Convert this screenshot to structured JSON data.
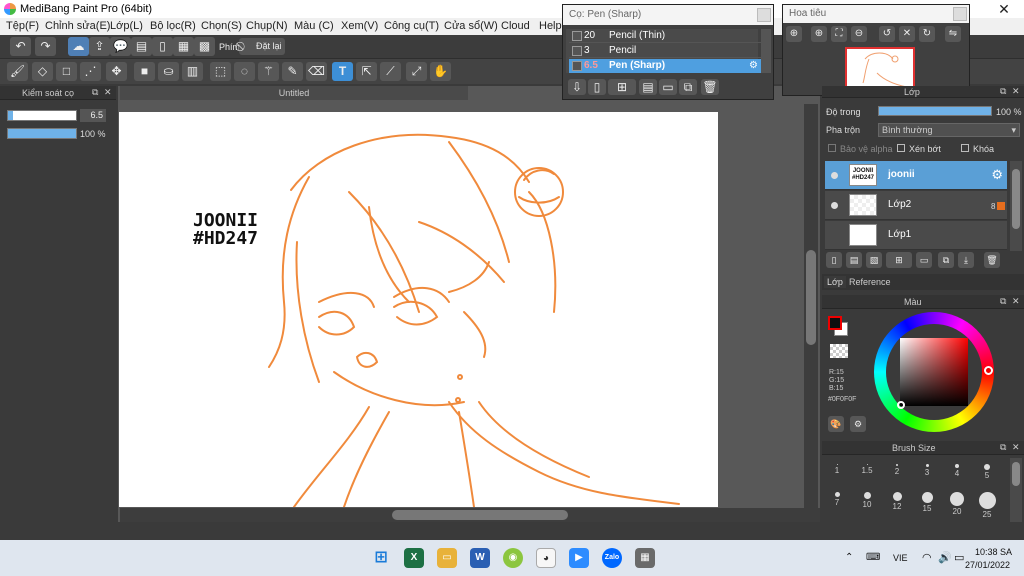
{
  "app": {
    "title": "MediBang Paint Pro (64bit)",
    "close_glyph": "✕"
  },
  "menu": [
    "Tệp(F)",
    "Chỉnh sửa(E)",
    "Lớp(L)",
    "Bộ lọc(R)",
    "Chọn(S)",
    "Chụp(N)",
    "Màu (C)",
    "Xem(V)",
    "Công cụ(T)",
    "Cửa sổ(W)",
    "Cloud",
    "Help"
  ],
  "toolbar": {
    "key_label": "Phím",
    "reset_label": "Đặt lại"
  },
  "brush_control": {
    "title": "Kiểm soát cọ",
    "size_value": "6.5",
    "opacity_value": "100 %",
    "size_fraction": 0.07,
    "opacity_fraction": 1.0
  },
  "canvas": {
    "tab": "Untitled",
    "signature_line1": "JOONII",
    "signature_line2": "#HD247"
  },
  "brush_list": {
    "title": "Cọ: Pen (Sharp)",
    "items": [
      {
        "size": "20",
        "name": "Pencil (Thin)"
      },
      {
        "size": "3",
        "name": "Pencil"
      },
      {
        "size": "6.5",
        "name": "Pen (Sharp)",
        "selected": true
      }
    ]
  },
  "navigator": {
    "title": "Hoa tiêu"
  },
  "layers": {
    "header": "Lớp",
    "opacity_label": "Độ trong",
    "opacity_value": "100 %",
    "opacity_fraction": 1.0,
    "blend_label": "Pha trộn",
    "blend_value": "Bình thường",
    "protect_alpha": "Bảo vệ alpha",
    "clipping": "Xén bớt",
    "lock": "Khóa",
    "items": [
      {
        "name": "joonii",
        "thumb_text": "JOONII #HD247",
        "selected": true
      },
      {
        "name": "Lớp2",
        "badge": "8"
      },
      {
        "name": "Lớp1"
      }
    ],
    "tabs": [
      "Lớp",
      "Reference"
    ]
  },
  "color": {
    "header": "Màu",
    "r": "R:15",
    "g": "G:15",
    "b": "B:15",
    "hex": "#0F0F0F",
    "primary": "#0f0f0f",
    "secondary": "#ffffff"
  },
  "brush_size": {
    "header": "Brush Size",
    "row1": [
      "1",
      "1.5",
      "2",
      "3",
      "4",
      "5"
    ],
    "row2": [
      "7",
      "10",
      "12",
      "15",
      "20",
      "25"
    ]
  },
  "taskbar": {
    "lang": "VIE",
    "time": "10:38 SA",
    "date": "27/01/2022"
  },
  "accent": "#4f9fe0"
}
